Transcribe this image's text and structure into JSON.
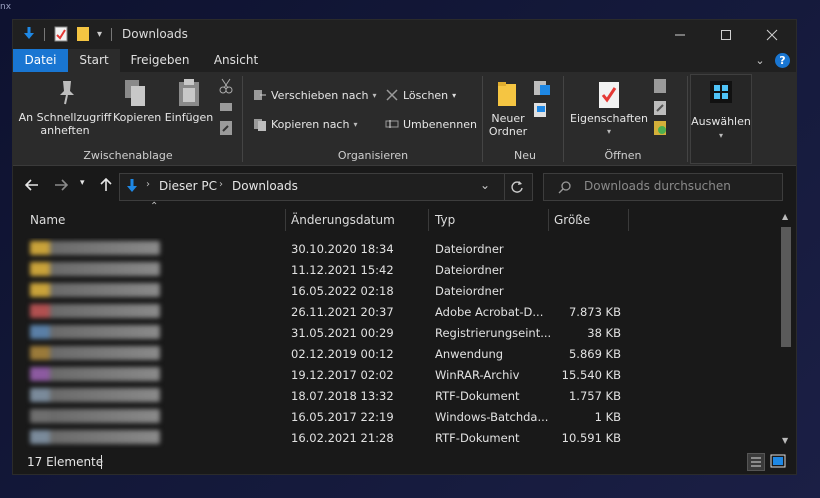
{
  "corner_text": "nx",
  "window": {
    "title": "Downloads",
    "controls": [
      "minimize-icon",
      "maximize-icon",
      "close-icon"
    ]
  },
  "ribbon_tabs": [
    "Datei",
    "Start",
    "Freigeben",
    "Ansicht"
  ],
  "help_label": "?",
  "ribbon": {
    "clipboard": {
      "pin_label_1": "An Schnellzugriff",
      "pin_label_2": "anheften",
      "copy_label": "Kopieren",
      "paste_label": "Einfügen",
      "group_label": "Zwischenablage"
    },
    "organize": {
      "move_label": "Verschieben nach",
      "copy_to_label": "Kopieren nach",
      "delete_label": "Löschen",
      "rename_label": "Umbenennen",
      "group_label": "Organisieren"
    },
    "new": {
      "new_folder_1": "Neuer",
      "new_folder_2": "Ordner",
      "group_label": "Neu"
    },
    "open": {
      "properties_label": "Eigenschaften",
      "group_label": "Öffnen"
    },
    "select": {
      "select_label": "Auswählen"
    }
  },
  "address": {
    "crumb_1": "Dieser PC",
    "crumb_2": "Downloads",
    "search_placeholder": "Downloads durchsuchen"
  },
  "columns": {
    "name": "Name",
    "date": "Änderungsdatum",
    "type": "Typ",
    "size": "Größe"
  },
  "files": [
    {
      "date": "30.10.2020 18:34",
      "type": "Dateiordner",
      "size": "",
      "color": "#c9a23a"
    },
    {
      "date": "11.12.2021 15:42",
      "type": "Dateiordner",
      "size": "",
      "color": "#c9a23a"
    },
    {
      "date": "16.05.2022 02:18",
      "type": "Dateiordner",
      "size": "",
      "color": "#c9a23a"
    },
    {
      "date": "26.11.2021 20:37",
      "type": "Adobe Acrobat-D...",
      "size": "7.873 KB",
      "color": "#b05050"
    },
    {
      "date": "31.05.2021 00:29",
      "type": "Registrierungseint...",
      "size": "38 KB",
      "color": "#5a7fa6"
    },
    {
      "date": "02.12.2019 00:12",
      "type": "Anwendung",
      "size": "5.869 KB",
      "color": "#9a7a3a"
    },
    {
      "date": "19.12.2017 02:02",
      "type": "WinRAR-Archiv",
      "size": "15.540 KB",
      "color": "#8c5aa0"
    },
    {
      "date": "18.07.2018 13:32",
      "type": "RTF-Dokument",
      "size": "1.757 KB",
      "color": "#7a8a9a"
    },
    {
      "date": "16.05.2017 22:19",
      "type": "Windows-Batchda...",
      "size": "1 KB",
      "color": "#6e6e6e"
    },
    {
      "date": "16.02.2021 21:28",
      "type": "RTF-Dokument",
      "size": "10.591 KB",
      "color": "#7a8a9a"
    }
  ],
  "status": {
    "count": "17 Elemente"
  }
}
